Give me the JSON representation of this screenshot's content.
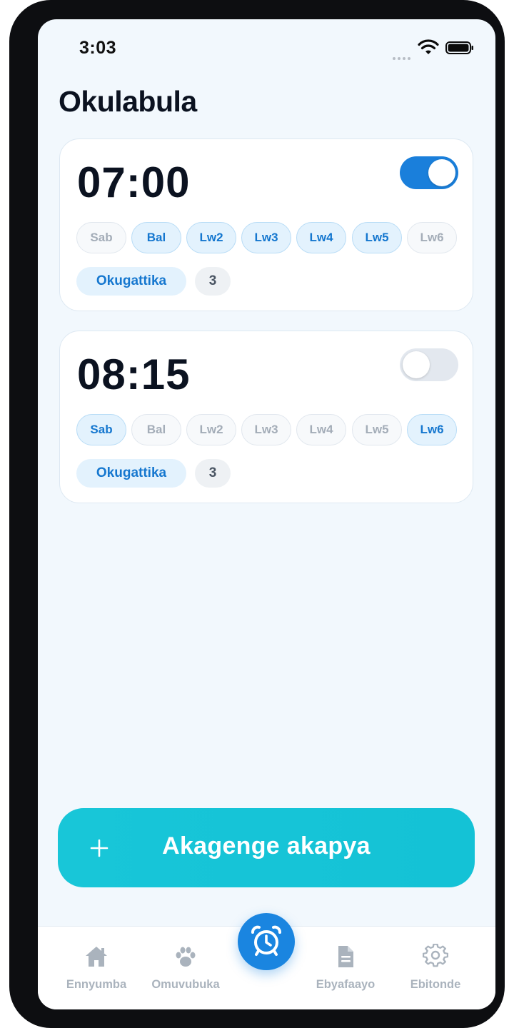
{
  "status_bar": {
    "time": "3:03"
  },
  "page_title": "Okulabula",
  "alarms": [
    {
      "time": "07:00",
      "enabled": true,
      "days": [
        {
          "label": "Sab",
          "active": false
        },
        {
          "label": "Bal",
          "active": true
        },
        {
          "label": "Lw2",
          "active": true
        },
        {
          "label": "Lw3",
          "active": true
        },
        {
          "label": "Lw4",
          "active": true
        },
        {
          "label": "Lw5",
          "active": true
        },
        {
          "label": "Lw6",
          "active": false
        }
      ],
      "label": "Okugattika",
      "count": "3"
    },
    {
      "time": "08:15",
      "enabled": false,
      "days": [
        {
          "label": "Sab",
          "active": true
        },
        {
          "label": "Bal",
          "active": false
        },
        {
          "label": "Lw2",
          "active": false
        },
        {
          "label": "Lw3",
          "active": false
        },
        {
          "label": "Lw4",
          "active": false
        },
        {
          "label": "Lw5",
          "active": false
        },
        {
          "label": "Lw6",
          "active": true
        }
      ],
      "label": "Okugattika",
      "count": "3"
    }
  ],
  "new_alarm_button": {
    "label": "Akagenge akapya",
    "icon": "plus-icon"
  },
  "tab_bar": {
    "tabs": [
      {
        "label": "Ennyumba",
        "icon": "home-icon"
      },
      {
        "label": "Omuvubuka",
        "icon": "paw-icon"
      },
      {
        "label": "",
        "icon": "alarm-clock-icon",
        "active": true
      },
      {
        "label": "Ebyafaayo",
        "icon": "document-icon"
      },
      {
        "label": "Ebitonde",
        "icon": "gear-icon"
      }
    ]
  },
  "colors": {
    "accent": "#1a85e0",
    "cta": "#18c6d8",
    "background": "#f2f8fd"
  }
}
